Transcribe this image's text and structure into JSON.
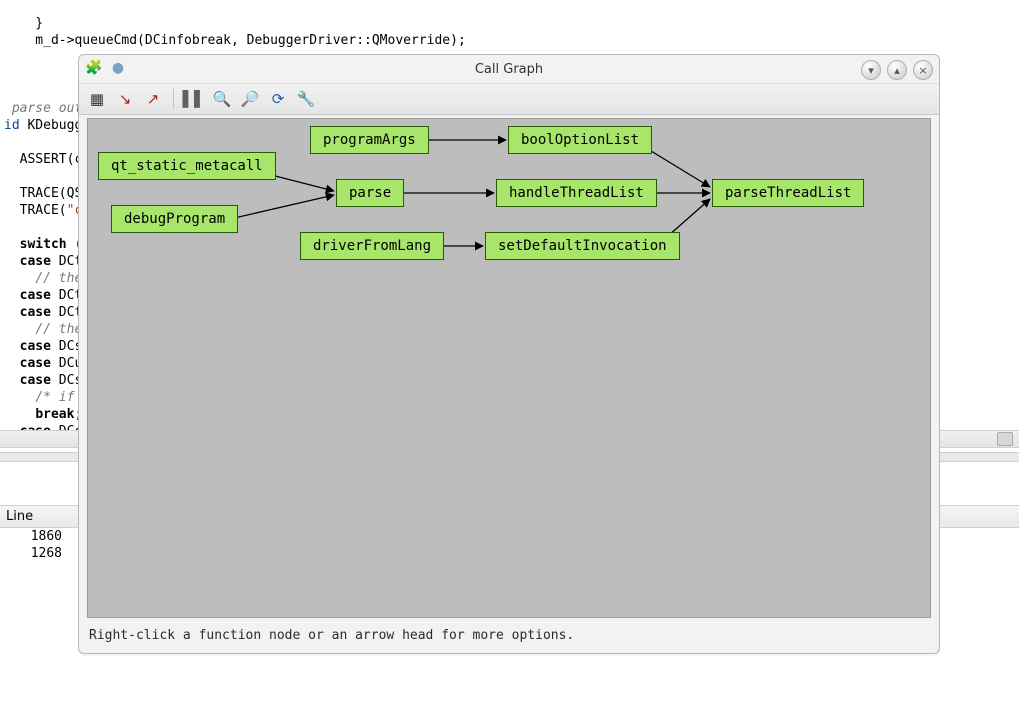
{
  "editor": {
    "lines": [
      "}",
      "m_d->queueCmd(DCinfobreak, DebuggerDriver::QMoverride);",
      "",
      "",
      "",
      " parse out",
      "id KDebugg",
      "",
      "  ASSERT(c",
      "",
      "  TRACE(QS",
      "  TRACE(\"c",
      "",
      "  switch (",
      "  case DCt",
      "    // the",
      "  case DCt",
      "  case DCt",
      "    // the",
      "  case DCs",
      "  case DCu",
      "  case DCs",
      "    /* if",
      "    break;",
      "  case DCc"
    ]
  },
  "lowerPanel": {
    "header": "Line",
    "rows": [
      "1860",
      "1268"
    ]
  },
  "callGraph": {
    "title": "Call Graph",
    "hint": "Right-click a function node or an arrow head for more options.",
    "nodes": {
      "qt_static_metacall": "qt_static_metacall",
      "debugProgram": "debugProgram",
      "programArgs": "programArgs",
      "parse": "parse",
      "driverFromLang": "driverFromLang",
      "boolOptionList": "boolOptionList",
      "handleThreadList": "handleThreadList",
      "setDefaultInvocation": "setDefaultInvocation",
      "parseThreadList": "parseThreadList"
    }
  },
  "chart_data": {
    "type": "diagram",
    "title": "Call Graph",
    "nodes": [
      "qt_static_metacall",
      "debugProgram",
      "programArgs",
      "parse",
      "driverFromLang",
      "boolOptionList",
      "handleThreadList",
      "setDefaultInvocation",
      "parseThreadList"
    ],
    "edges": [
      [
        "qt_static_metacall",
        "parse"
      ],
      [
        "debugProgram",
        "parse"
      ],
      [
        "programArgs",
        "boolOptionList"
      ],
      [
        "parse",
        "handleThreadList"
      ],
      [
        "driverFromLang",
        "setDefaultInvocation"
      ],
      [
        "boolOptionList",
        "parseThreadList"
      ],
      [
        "handleThreadList",
        "parseThreadList"
      ],
      [
        "setDefaultInvocation",
        "parseThreadList"
      ]
    ]
  }
}
